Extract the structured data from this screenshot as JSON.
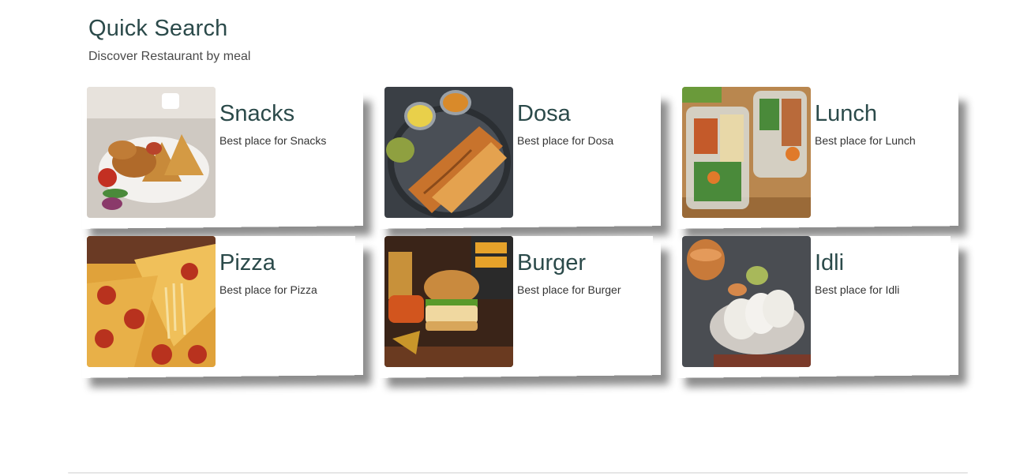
{
  "section": {
    "title": "Quick Search",
    "subtitle": "Discover Restaurant by meal"
  },
  "meals": [
    {
      "name": "Snacks",
      "description": "Best place for Snacks",
      "icon": "samosa-plate-image"
    },
    {
      "name": "Dosa",
      "description": "Best place for Dosa",
      "icon": "dosa-plate-image"
    },
    {
      "name": "Lunch",
      "description": "Best place for Lunch",
      "icon": "lunch-box-image"
    },
    {
      "name": "Pizza",
      "description": "Best place for Pizza",
      "icon": "pizza-image"
    },
    {
      "name": "Burger",
      "description": "Best place for Burger",
      "icon": "burger-image"
    },
    {
      "name": "Idli",
      "description": "Best place for Idli",
      "icon": "idli-image"
    }
  ],
  "colors": {
    "heading": "#2b4a4a",
    "text": "#333333",
    "background": "#ffffff"
  }
}
